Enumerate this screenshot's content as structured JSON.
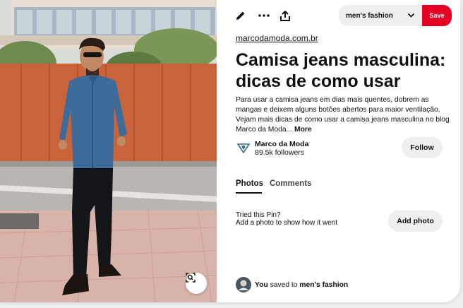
{
  "toolbar": {
    "icons": [
      "pencil-icon",
      "more-icon",
      "share-icon"
    ],
    "board_select": "men's fashion",
    "save_label": "Save"
  },
  "pin": {
    "source": "marcodamoda.com.br",
    "title": "Camisa jeans masculina: dicas de como usar",
    "description": "Para usar a camisa jeans em dias mais quentes, dobrem as mangas e deixem alguns botões abertos para maior ventilação. Vejam mais dicas de como usar a camisa jeans masculina no blog Marco da Moda...",
    "more_label": "More"
  },
  "creator": {
    "name": "Marco da Moda",
    "followers": "89.5k followers",
    "follow_label": "Follow"
  },
  "tabs": [
    {
      "label": "Photos",
      "active": true
    },
    {
      "label": "Comments",
      "active": false
    }
  ],
  "tried": {
    "title": "Tried this Pin?",
    "subtitle": "Add a photo to show how it went",
    "button": "Add photo"
  },
  "saved": {
    "actor": "You",
    "text": "saved to",
    "board": "men's fashion"
  },
  "colors": {
    "save_red": "#e60023",
    "button_gray": "#efefef"
  }
}
